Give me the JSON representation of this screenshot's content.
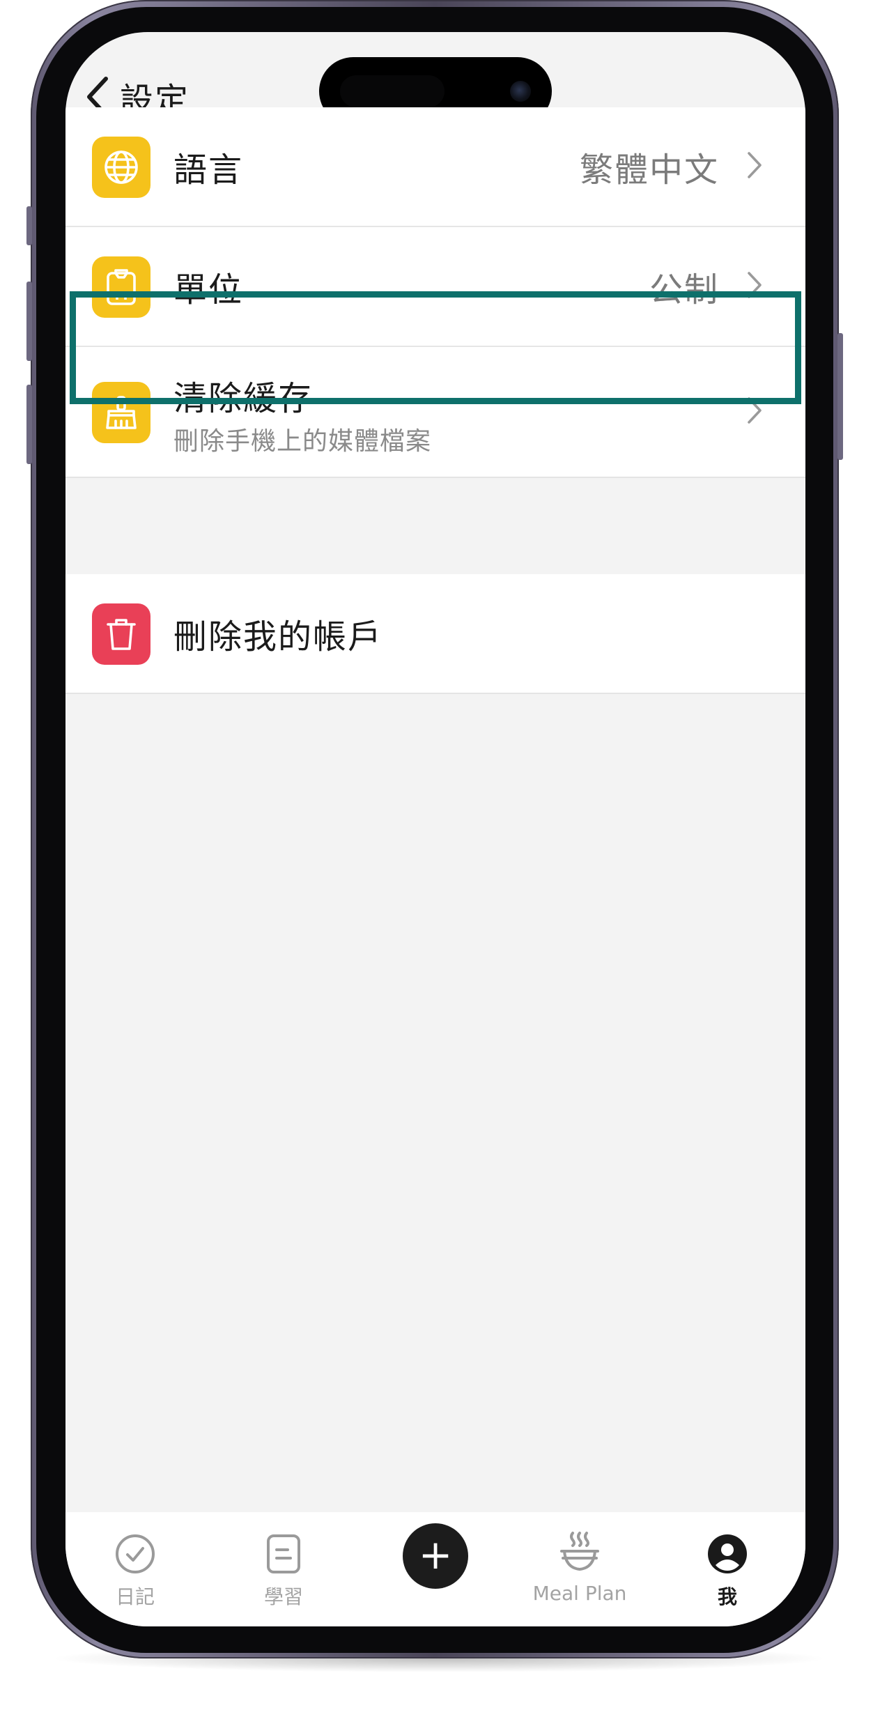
{
  "header": {
    "back_icon": "chevron-left-icon",
    "title": "設定"
  },
  "settings_group_1": [
    {
      "icon": "globe-icon",
      "label": "語言",
      "value": "繁體中文",
      "chevron": "chevron-right-icon"
    },
    {
      "icon": "clipboard-icon",
      "label": "單位",
      "value": "公制",
      "chevron": "chevron-right-icon"
    },
    {
      "icon": "broom-icon",
      "label": "清除緩存",
      "sublabel": "刪除手機上的媒體檔案",
      "chevron": "chevron-right-icon"
    }
  ],
  "settings_group_2": [
    {
      "icon": "trash-icon",
      "label": "刪除我的帳戶"
    }
  ],
  "tabbar": {
    "tabs": [
      {
        "icon": "check-circle-icon",
        "label": "日記"
      },
      {
        "icon": "note-icon",
        "label": "學習"
      },
      {
        "icon": "plus-icon",
        "label": "+"
      },
      {
        "icon": "bowl-icon",
        "label": "Meal Plan"
      },
      {
        "icon": "user-icon",
        "label": "我"
      }
    ],
    "active": "我"
  },
  "colors": {
    "icon_yellow": "#f5c21b",
    "icon_red": "#e94057",
    "highlight_border": "#0e706b",
    "screen_background": "#f3f3f3"
  }
}
